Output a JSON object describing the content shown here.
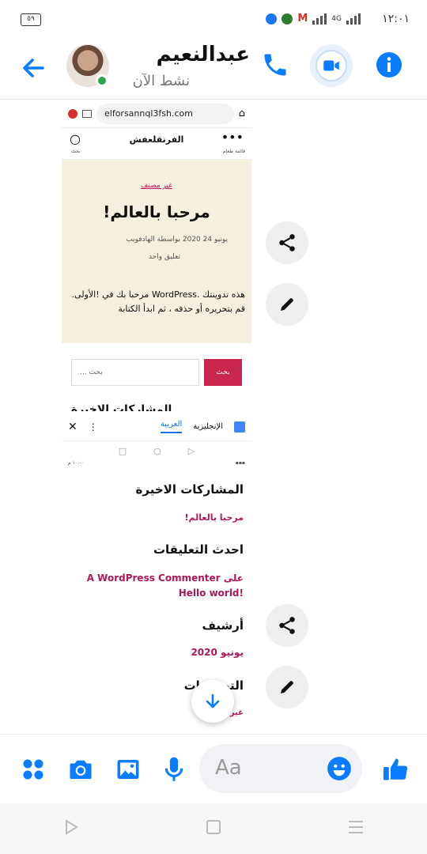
{
  "status": {
    "time": "١٢:٠١",
    "battery": "٥٩",
    "network": "4G"
  },
  "header": {
    "contact_name": "عبدالنعيم",
    "presence": "نشط الآن",
    "accent": "#0a7cff"
  },
  "shot1": {
    "url": "elforsannql3fsh.com",
    "site_title": "الفرنقلعفش",
    "left_label": "بحث",
    "right_label": "قائمة طعام",
    "category": "غير مصنف",
    "post_title": "!مرحبا بالعالم",
    "meta": "يونيو 24 2020   بواسطة الهادفويب",
    "comment": "تعليق واحد",
    "excerpt": "هذه تدوينتك .WordPress مرحبا بك في !الأولى. قم بتحريره أو حذفه ، ثم ابدأ الكتابة",
    "search_placeholder": "... بحث",
    "search_button": "بحث",
    "partial_heading": "المشاركات الاخيرة"
  },
  "shot2": {
    "tab_english": "الإنجليزية",
    "tab_arabic": "العربية",
    "mini_time": "١٠:٠٠ م",
    "recent_title": "المشاركات الاخيرة",
    "recent_link": "!مرحبا بالعالم",
    "comments_title": "احدث التعليقات",
    "comment_link": "A WordPress Commenter على Hello world!",
    "archive_title": "أرشيف",
    "archive_link": "يونيو 2020",
    "categories_title": "التصنيفات",
    "category_link": "غير مصنف"
  },
  "composer": {
    "placeholder": "Aa"
  }
}
